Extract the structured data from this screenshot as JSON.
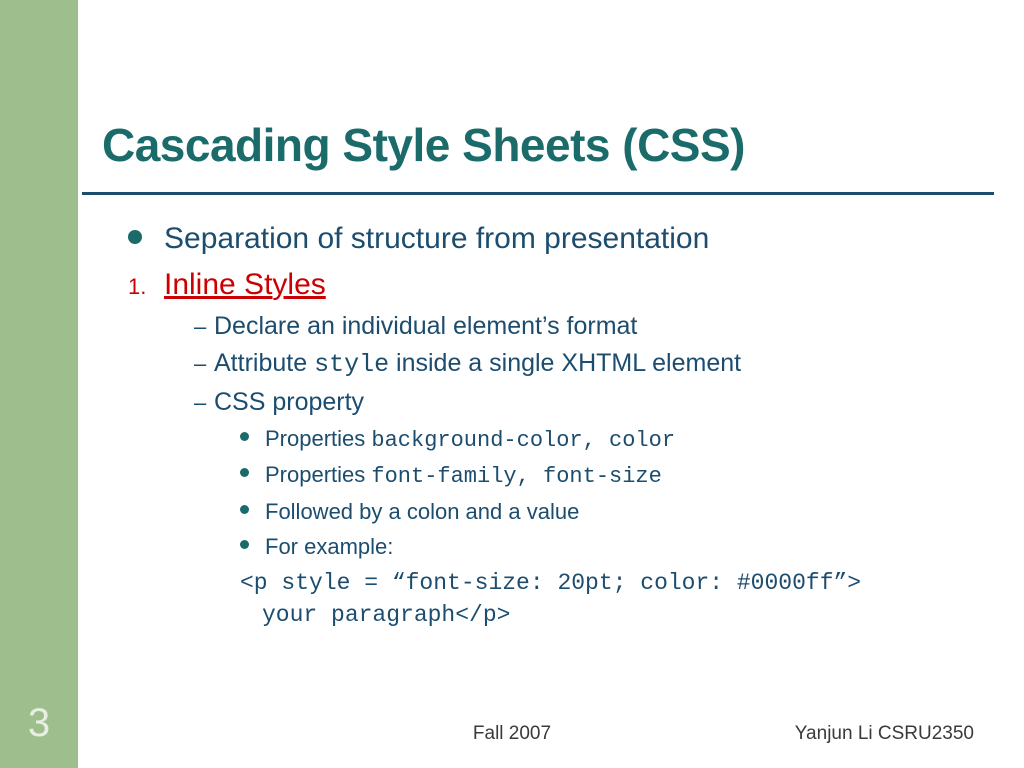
{
  "slide": {
    "page_number": "3",
    "title": "Cascading Style Sheets (CSS)",
    "bullets": {
      "b1": "Separation of structure from presentation"
    },
    "numbered": {
      "marker": "1.",
      "label": "Inline Styles"
    },
    "sub1": {
      "a": "Declare an individual element’s format",
      "b_pre": "Attribute ",
      "b_code": "style",
      "b_post": "  inside a single XHTML element",
      "c": "CSS property"
    },
    "sub2": {
      "a_pre": "Properties ",
      "a_code": "background-color, color",
      "b_pre": "Properties ",
      "b_code": "font-family, font-size",
      "c": "Followed by a colon and a value",
      "d": "For example:"
    },
    "code": {
      "line1": "<p style = “font-size: 20pt; color: #0000ff”>",
      "line2": "your paragraph</p>"
    }
  },
  "footer": {
    "center": "Fall 2007",
    "right": "Yanjun Li    CSRU2350"
  },
  "colors": {
    "accent_green": "#9ebf8d",
    "title_teal": "#1b6b6b",
    "body_navy": "#1c4d6f",
    "link_red": "#cc0000"
  }
}
